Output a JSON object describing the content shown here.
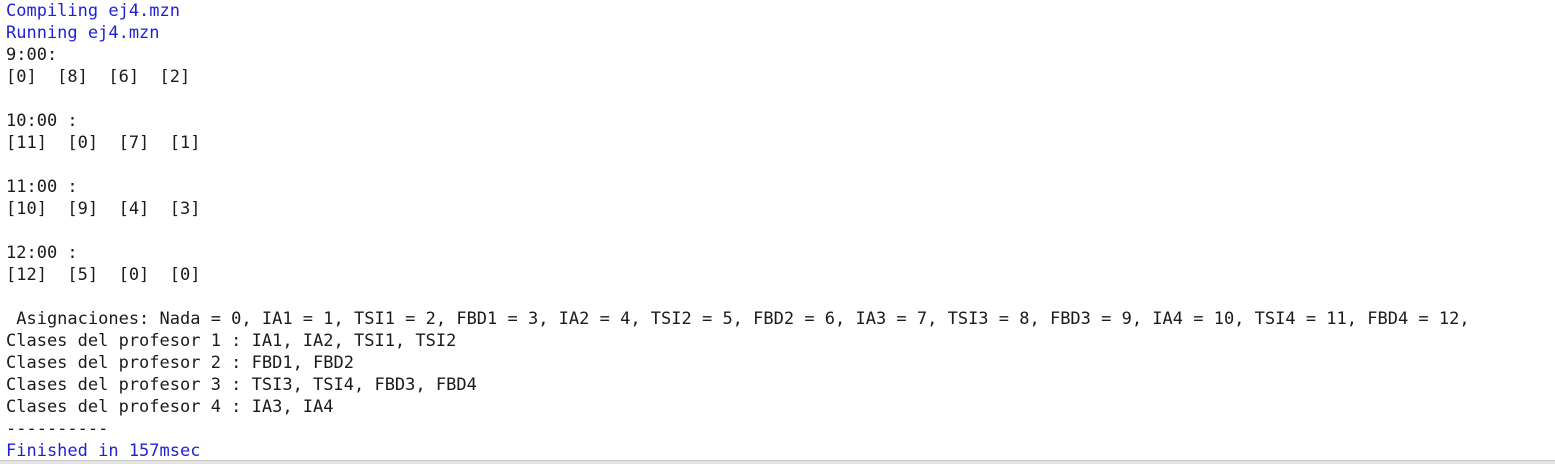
{
  "colors": {
    "info_text": "#1f1fd8",
    "output_text": "#1a1a1a",
    "background": "#ffffff"
  },
  "output": {
    "compiling": "Compiling ej4.mzn",
    "running": "Running ej4.mzn",
    "lines": [
      "9:00:",
      "[0]  [8]  [6]  [2]",
      "",
      "10:00 :",
      "[11]  [0]  [7]  [1]",
      "",
      "11:00 :",
      "[10]  [9]  [4]  [3]",
      "",
      "12:00 :",
      "[12]  [5]  [0]  [0]",
      "",
      " Asignaciones: Nada = 0, IA1 = 1, TSI1 = 2, FBD1 = 3, IA2 = 4, TSI2 = 5, FBD2 = 6, IA3 = 7, TSI3 = 8, FBD3 = 9, IA4 = 10, TSI4 = 11, FBD4 = 12,",
      "Clases del profesor 1 : IA1, IA2, TSI1, TSI2",
      "Clases del profesor 2 : FBD1, FBD2",
      "Clases del profesor 3 : TSI3, TSI4, FBD3, FBD4",
      "Clases del profesor 4 : IA3, IA4",
      "----------"
    ],
    "finished": "Finished in 157msec"
  }
}
